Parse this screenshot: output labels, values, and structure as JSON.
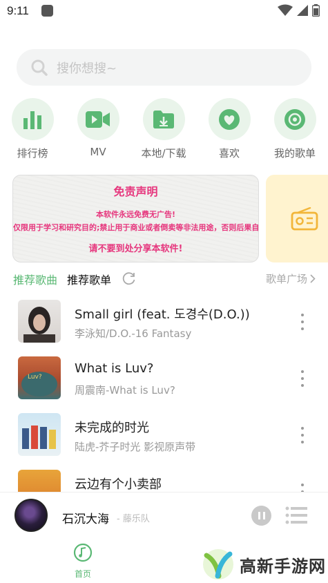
{
  "status": {
    "time": "9:11"
  },
  "search": {
    "placeholder": "搜你想搜~"
  },
  "entries": [
    {
      "label": "排行榜",
      "icon": "bar-chart-icon"
    },
    {
      "label": "MV",
      "icon": "video-camera-icon"
    },
    {
      "label": "本地/下载",
      "icon": "download-folder-icon"
    },
    {
      "label": "喜欢",
      "icon": "heart-icon"
    },
    {
      "label": "我的歌单",
      "icon": "music-disc-icon"
    }
  ],
  "banner": {
    "title": "免责声明",
    "line1": "本软件永远免费无广告!",
    "line2": "仅限用于学习和研究目的;禁止用于商业或者倒卖等非法用途，否则后果自负。",
    "line3": "请不要到处分享本软件!"
  },
  "section": {
    "tab_songs": "推荐歌曲",
    "tab_playlists": "推荐歌单",
    "square_link": "歌单广场"
  },
  "songs": [
    {
      "title": "Small girl (feat. 도경수(D.O.))",
      "subtitle": "李泳知/D.O.-16 Fantasy"
    },
    {
      "title": "What is Luv?",
      "subtitle": "周震南-What is Luv?"
    },
    {
      "title": "未完成的时光",
      "subtitle": "陆虎-芥子时光 影视原声带"
    },
    {
      "title": "云边有个小卖部",
      "subtitle": ""
    }
  ],
  "player": {
    "title": "石沉大海",
    "artist": "- 藤乐队"
  },
  "nav": {
    "home_label": "首页"
  },
  "watermark": {
    "text": "高新手游网"
  },
  "colors": {
    "accent": "#5ab874",
    "banner_text": "#e6367d",
    "entry_bg": "#e9f4ea"
  }
}
